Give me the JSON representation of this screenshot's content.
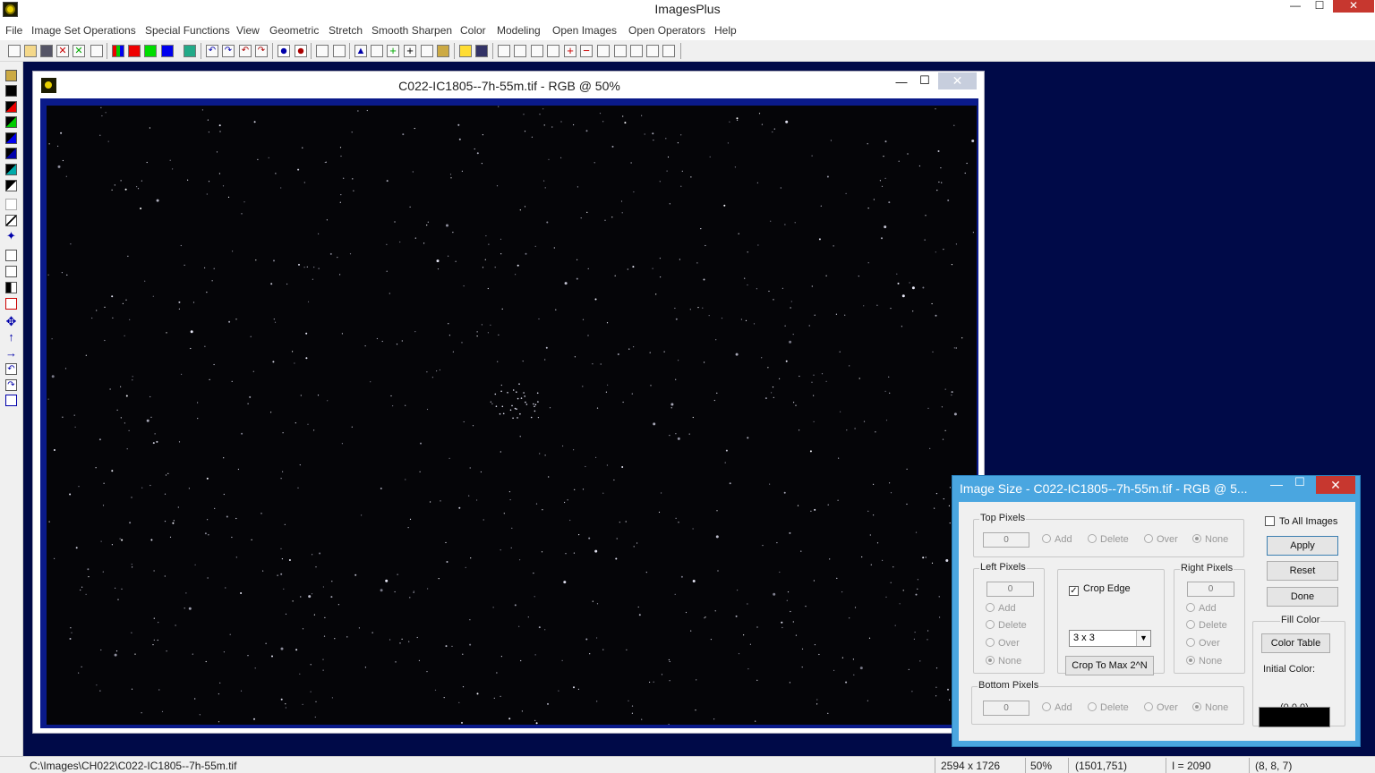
{
  "app": {
    "title": "ImagesPlus",
    "min": "—",
    "max": "☐",
    "close": "✕"
  },
  "menu": [
    "File",
    "Image Set Operations",
    "Special Functions",
    "View",
    "Geometric",
    "Stretch",
    "Smooth Sharpen",
    "Color",
    "Modeling",
    "Open Images",
    "Open Operators",
    "Help"
  ],
  "image_window": {
    "title": "C022-IC1805--7h-55m.tif - RGB @ 50%",
    "min": "—",
    "max": "☐",
    "close": "✕"
  },
  "dialog": {
    "title": "Image Size - C022-IC1805--7h-55m.tif - RGB @ 5...",
    "min": "—",
    "max": "☐",
    "close": "✕",
    "top": {
      "label": "Top Pixels",
      "value": "0",
      "add": "Add",
      "delete": "Delete",
      "over": "Over",
      "none": "None"
    },
    "left": {
      "label": "Left Pixels",
      "value": "0",
      "add": "Add",
      "delete": "Delete",
      "over": "Over",
      "none": "None"
    },
    "right": {
      "label": "Right Pixels",
      "value": "0",
      "add": "Add",
      "delete": "Delete",
      "over": "Over",
      "none": "None"
    },
    "bottom": {
      "label": "Bottom Pixels",
      "value": "0",
      "add": "Add",
      "delete": "Delete",
      "over": "Over",
      "none": "None"
    },
    "crop_edge": {
      "label": "Crop Edge",
      "check": "✓",
      "select_value": "3 x 3",
      "arrow": "▼",
      "max_button": "Crop To Max 2^N"
    },
    "to_all_images": "To All Images",
    "apply": "Apply",
    "reset": "Reset",
    "done": "Done",
    "fill_color": {
      "label": "Fill Color",
      "button": "Color Table",
      "initial_label": "Initial Color:",
      "value": "(0,0,0)",
      "swatch_color": "#000000"
    }
  },
  "status": {
    "path": "C:\\Images\\CH022\\C022-IC1805--7h-55m.tif",
    "dimensions": "2594 x 1726",
    "zoom": "50%",
    "coords": "(1501,751)",
    "intensity": "I = 2090",
    "rgb": "(8, 8, 7)"
  }
}
